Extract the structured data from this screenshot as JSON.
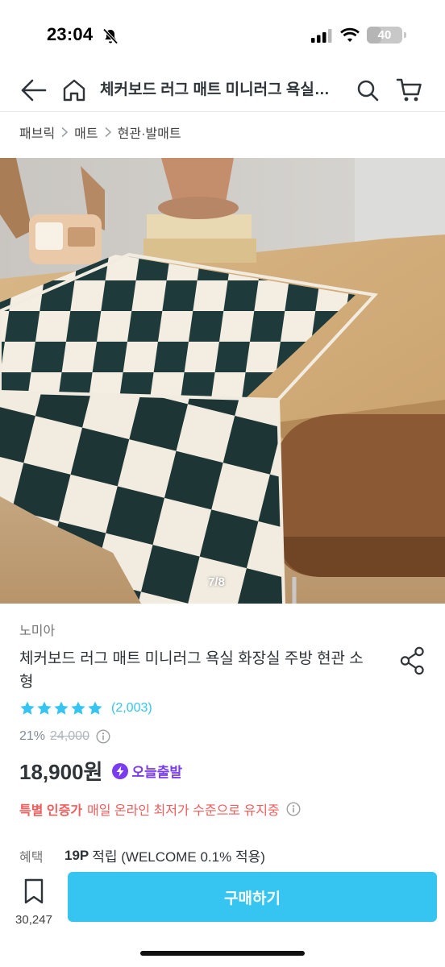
{
  "status": {
    "time": "23:04",
    "battery": "40",
    "battery_level": 0.4
  },
  "nav": {
    "title": "체커보드 러그 매트 미니러그 욕실…"
  },
  "breadcrumb": [
    "패브릭",
    "매트",
    "현관·발매트"
  ],
  "gallery": {
    "counter": "7/8"
  },
  "product": {
    "brand": "노미아",
    "name": "체커보드 러그 매트 미니러그 욕실 화장실 주방 현관 소형",
    "rating": 5,
    "reviews": "(2,003)",
    "discount": "21%",
    "original_price": "24,000",
    "price": "18,900원",
    "today_badge": "오늘출발"
  },
  "promo": {
    "strong": "특별 인증가",
    "text": "매일 온라인 최저가 수준으로 유지중"
  },
  "benefit": {
    "label": "혜택",
    "points": "19P",
    "text": "적립 (WELCOME 0.1% 적용)"
  },
  "bottom": {
    "bookmark_count": "30,247",
    "buy_label": "구매하기"
  },
  "colors": {
    "accent": "#35c5f0",
    "promo": "#f05d5d",
    "today": "#7a3cf0"
  }
}
